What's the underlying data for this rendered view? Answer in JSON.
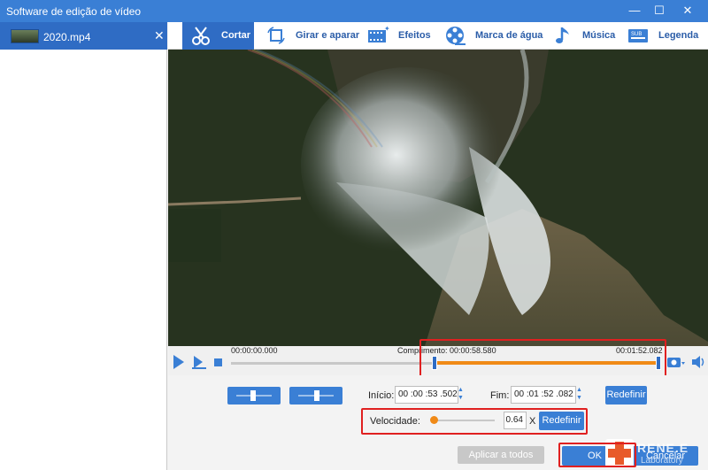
{
  "window": {
    "title": "Software de edição de vídeo",
    "minimize": "—",
    "maximize": "☐",
    "close": "✕"
  },
  "sidebar": {
    "file_name": "2020.mp4",
    "remove": "✕"
  },
  "tabs": [
    {
      "label": "Cortar",
      "icon": "scissors-icon",
      "active": true
    },
    {
      "label": "Girar e aparar",
      "icon": "crop-rotate-icon"
    },
    {
      "label": "Efeitos",
      "icon": "film-effects-icon"
    },
    {
      "label": "Marca de água",
      "icon": "film-reel-icon"
    },
    {
      "label": "Música",
      "icon": "music-note-icon"
    },
    {
      "label": "Legenda",
      "icon": "subtitle-icon"
    }
  ],
  "timeline": {
    "start_time": "00:00:00.000",
    "length_text": "Comprimento: 00:00:58.580",
    "end_time": "00:01:52.082"
  },
  "trim": {
    "start_label": "Início:",
    "start_value": "00 :00 :53 .502",
    "end_label": "Fim:",
    "end_value": "00 :01 :52 .082",
    "reset_label": "Redefinir"
  },
  "speed": {
    "label": "Velocidade:",
    "value": "0.64",
    "unit": "X",
    "reset_label": "Redefinir"
  },
  "footer": {
    "apply_all": "Aplicar a todos",
    "ok": "OK",
    "cancel": "Cancelar",
    "watermark_brand": "RENE.E",
    "watermark_sub": "Laboratory"
  },
  "colors": {
    "accent": "#3a7fd5",
    "selection": "#f08a17",
    "highlight": "#e02020"
  }
}
